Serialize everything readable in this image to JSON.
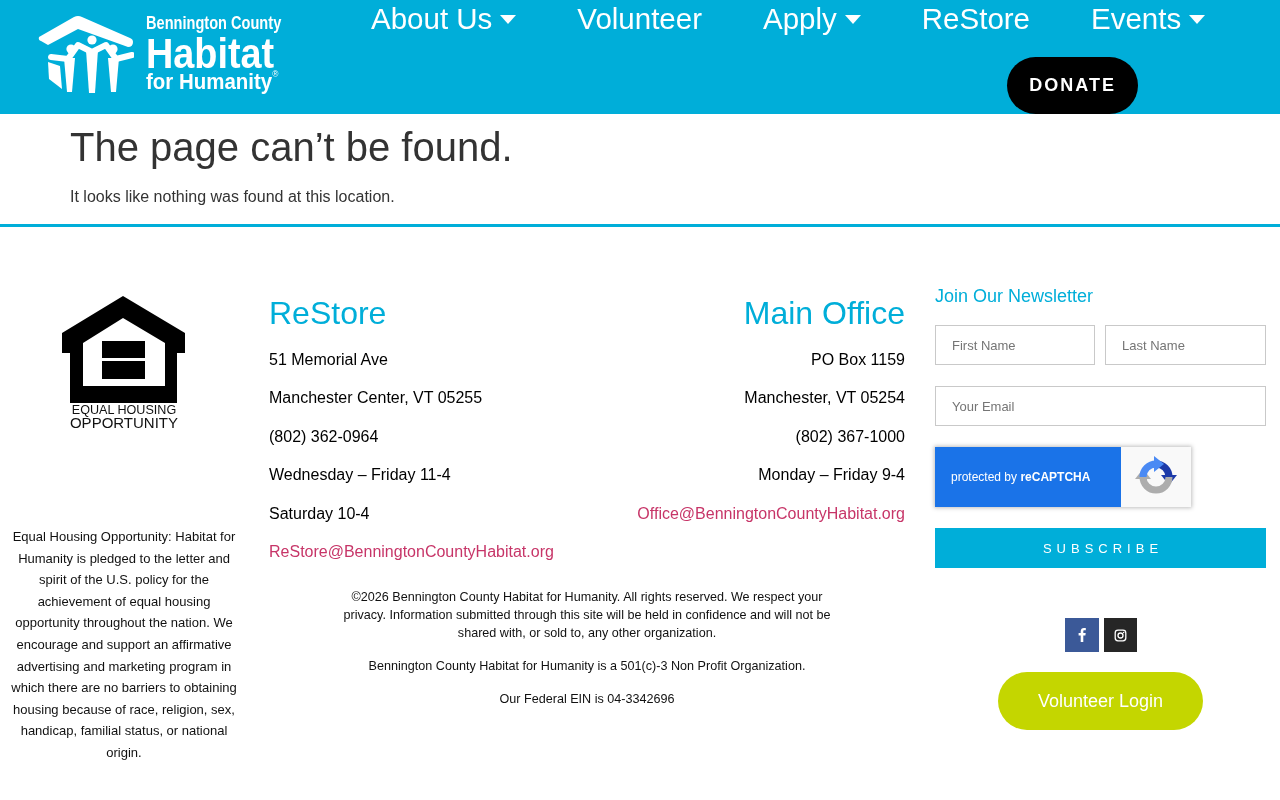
{
  "header": {
    "logo": {
      "lines": [
        "Bennington County",
        "Habitat",
        "for Humanity$^{®}$"
      ]
    },
    "nav": [
      {
        "label": "About Us",
        "has_dropdown": true
      },
      {
        "label": "Volunteer",
        "has_dropdown": false
      },
      {
        "label": "Apply",
        "has_dropdown": true
      },
      {
        "label": "ReStore",
        "has_dropdown": false
      },
      {
        "label": "Events",
        "has_dropdown": true
      }
    ],
    "donate_button": "DONATE"
  },
  "main": {
    "title": "The page can’t be found.",
    "message": "It looks like nothing was found at this location."
  },
  "footer": {
    "equal_housing": {
      "logo_lines": [
        "EQUAL HOUSING",
        "OPPORTUNITY"
      ],
      "statement": "Equal Housing Opportunity: Habitat for Humanity is pledged to the letter and spirit of the U.S. policy for the achievement of equal housing opportunity throughout the nation. We encourage and support an affirmative advertising and marketing program in which there are no barriers to obtaining housing because of race, religion, sex, handicap, familial status, or national origin."
    },
    "locations": [
      {
        "heading": "ReStore",
        "lines": [
          "51 Memorial Ave",
          "Manchester Center, VT 05255",
          "(802) 362-0964",
          "Wednesday – Friday 11-4",
          "Saturday 10-4"
        ],
        "email": "ReStore@BenningtonCountyHabitat.org"
      },
      {
        "heading": "Main Office",
        "lines": [
          "PO Box 1159",
          "Manchester, VT 05254",
          "(802) 367-1000",
          "Monday – Friday 9-4"
        ],
        "email": "Office@BenningtonCountyHabitat.org"
      }
    ],
    "legal": [
      "©2026 Bennington County Habitat for Humanity. All rights reserved. We respect your privacy. Information submitted through this site will be held in confidence and will not be shared with, or sold to, any other organization.",
      "Bennington County Habitat for Humanity is a 501(c)-3 Non Profit Organization.",
      "Our Federal EIN is 04-3342696"
    ],
    "newsletter": {
      "heading": "Join Our Newsletter",
      "fields": [
        {
          "placeholder": "First Name"
        },
        {
          "placeholder": "Last Name"
        },
        {
          "placeholder": "Your Email"
        }
      ],
      "recaptcha": "protected by **reCAPTCHA**",
      "subscribe_button": "SUBSCRIBE"
    },
    "social": [
      {
        "kind": "facebook"
      },
      {
        "kind": "instagram"
      }
    ],
    "volunteer_login_button": "Volunteer Login"
  }
}
